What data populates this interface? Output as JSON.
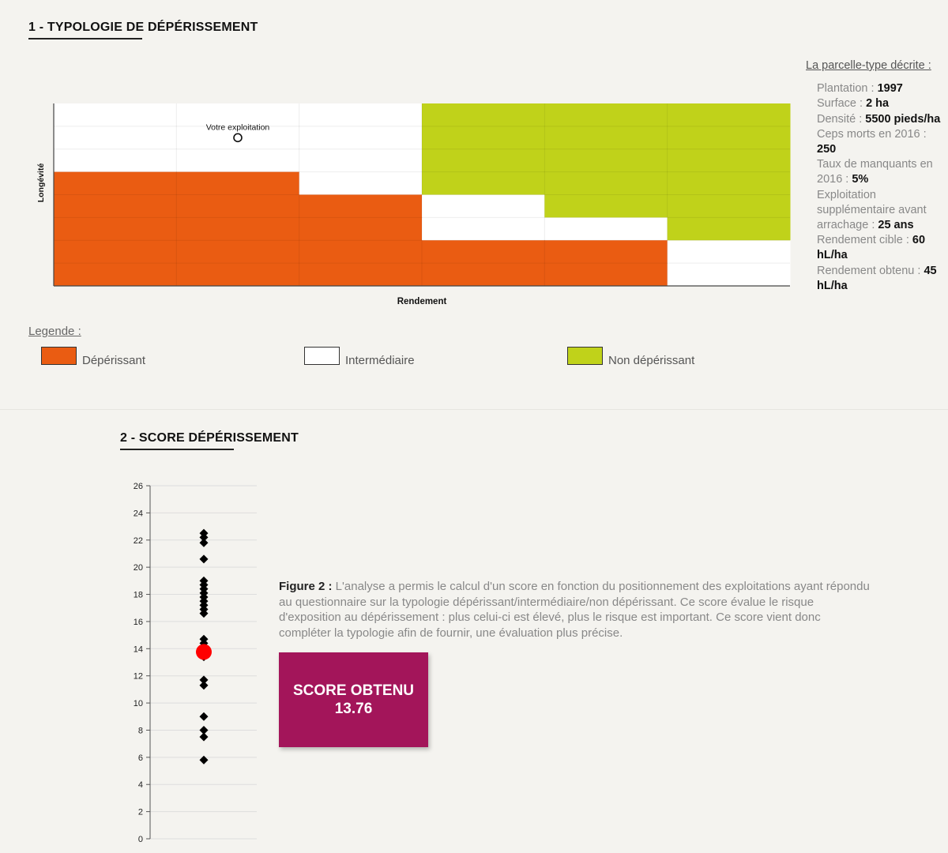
{
  "section1": {
    "title": "1 - TYPOLOGIE DE DÉPÉRISSEMENT",
    "sidebar": {
      "title": "La parcelle-type décrite :",
      "params": [
        {
          "label": "Plantation : ",
          "value": "1997"
        },
        {
          "label": "Surface : ",
          "value": "2 ha"
        },
        {
          "label": "Densité : ",
          "value": "5500 pieds/ha"
        },
        {
          "label": "Ceps morts en 2016 : ",
          "value": "250"
        },
        {
          "label": "Taux de manquants en 2016 : ",
          "value": "5%"
        },
        {
          "label": "Exploitation supplémentaire avant arrachage : ",
          "value": "25 ans"
        },
        {
          "label": "Rendement cible : ",
          "value": "60 hL/ha"
        },
        {
          "label": "Rendement obtenu : ",
          "value": "45 hL/ha"
        }
      ]
    },
    "legend": {
      "title": "Legende :",
      "items": [
        {
          "label": "Dépérissant",
          "color": "#ea5c12"
        },
        {
          "label": "Intermédiaire",
          "color": "#ffffff"
        },
        {
          "label": "Non dépérissant",
          "color": "#c0d21a"
        }
      ]
    }
  },
  "section2": {
    "title": "2 - SCORE DÉPÉRISSEMENT",
    "figure_text": {
      "bold": "Figure 2 :",
      "lines": [
        " L'analyse a permis le calcul d'un score en fonction du positionnement des exploitations ayant répondu",
        "au questionnaire sur la typologie dépérissant/intermédiaire/non dépérissant. Ce score évalue le risque",
        "d'exposition au dépérissement : plus celui-ci est élevé, plus le risque est important. Ce score vient donc",
        "compléter la typologie afin de fournir, une évaluation plus précise."
      ]
    },
    "score_box": {
      "label": "SCORE OBTENU",
      "value": "13.76"
    }
  },
  "chart_data": [
    {
      "type": "heatmap",
      "title": "",
      "xlabel": "Rendement",
      "ylabel": "Longévité",
      "columns": 6,
      "rows": 8,
      "colors": {
        "D": "#ea5c12",
        "I": "#ffffff",
        "N": "#c0d21a"
      },
      "grid": [
        [
          "I",
          "I",
          "I",
          "N",
          "N",
          "N"
        ],
        [
          "I",
          "I",
          "I",
          "N",
          "N",
          "N"
        ],
        [
          "I",
          "I",
          "I",
          "N",
          "N",
          "N"
        ],
        [
          "D",
          "D",
          "I",
          "N",
          "N",
          "N"
        ],
        [
          "D",
          "D",
          "D",
          "I",
          "N",
          "N"
        ],
        [
          "D",
          "D",
          "D",
          "I",
          "I",
          "N"
        ],
        [
          "D",
          "D",
          "D",
          "D",
          "D",
          "I"
        ],
        [
          "D",
          "D",
          "D",
          "D",
          "D",
          "I"
        ]
      ],
      "annotation": {
        "label": "Votre exploitation",
        "col": 1.5,
        "row": 1.5
      }
    },
    {
      "type": "scatter",
      "title": "",
      "xlabel": "",
      "ylabel": "",
      "ylim": [
        0,
        26
      ],
      "yticks": [
        0,
        2,
        4,
        6,
        8,
        10,
        12,
        14,
        16,
        18,
        20,
        22,
        24,
        26
      ],
      "grid": true,
      "series": [
        {
          "values": [
            22.5,
            22.2,
            21.8,
            20.6,
            19.0,
            18.7,
            18.4,
            18.1,
            17.8,
            17.5,
            17.2,
            16.9,
            16.6,
            14.7,
            14.4,
            14.1,
            13.4,
            11.7,
            11.3,
            9.0,
            8.0,
            7.5,
            5.8
          ],
          "color": "#000000",
          "marker": "diamond"
        },
        {
          "values": [
            13.76
          ],
          "color": "#ff0000",
          "marker": "circle"
        }
      ]
    }
  ]
}
